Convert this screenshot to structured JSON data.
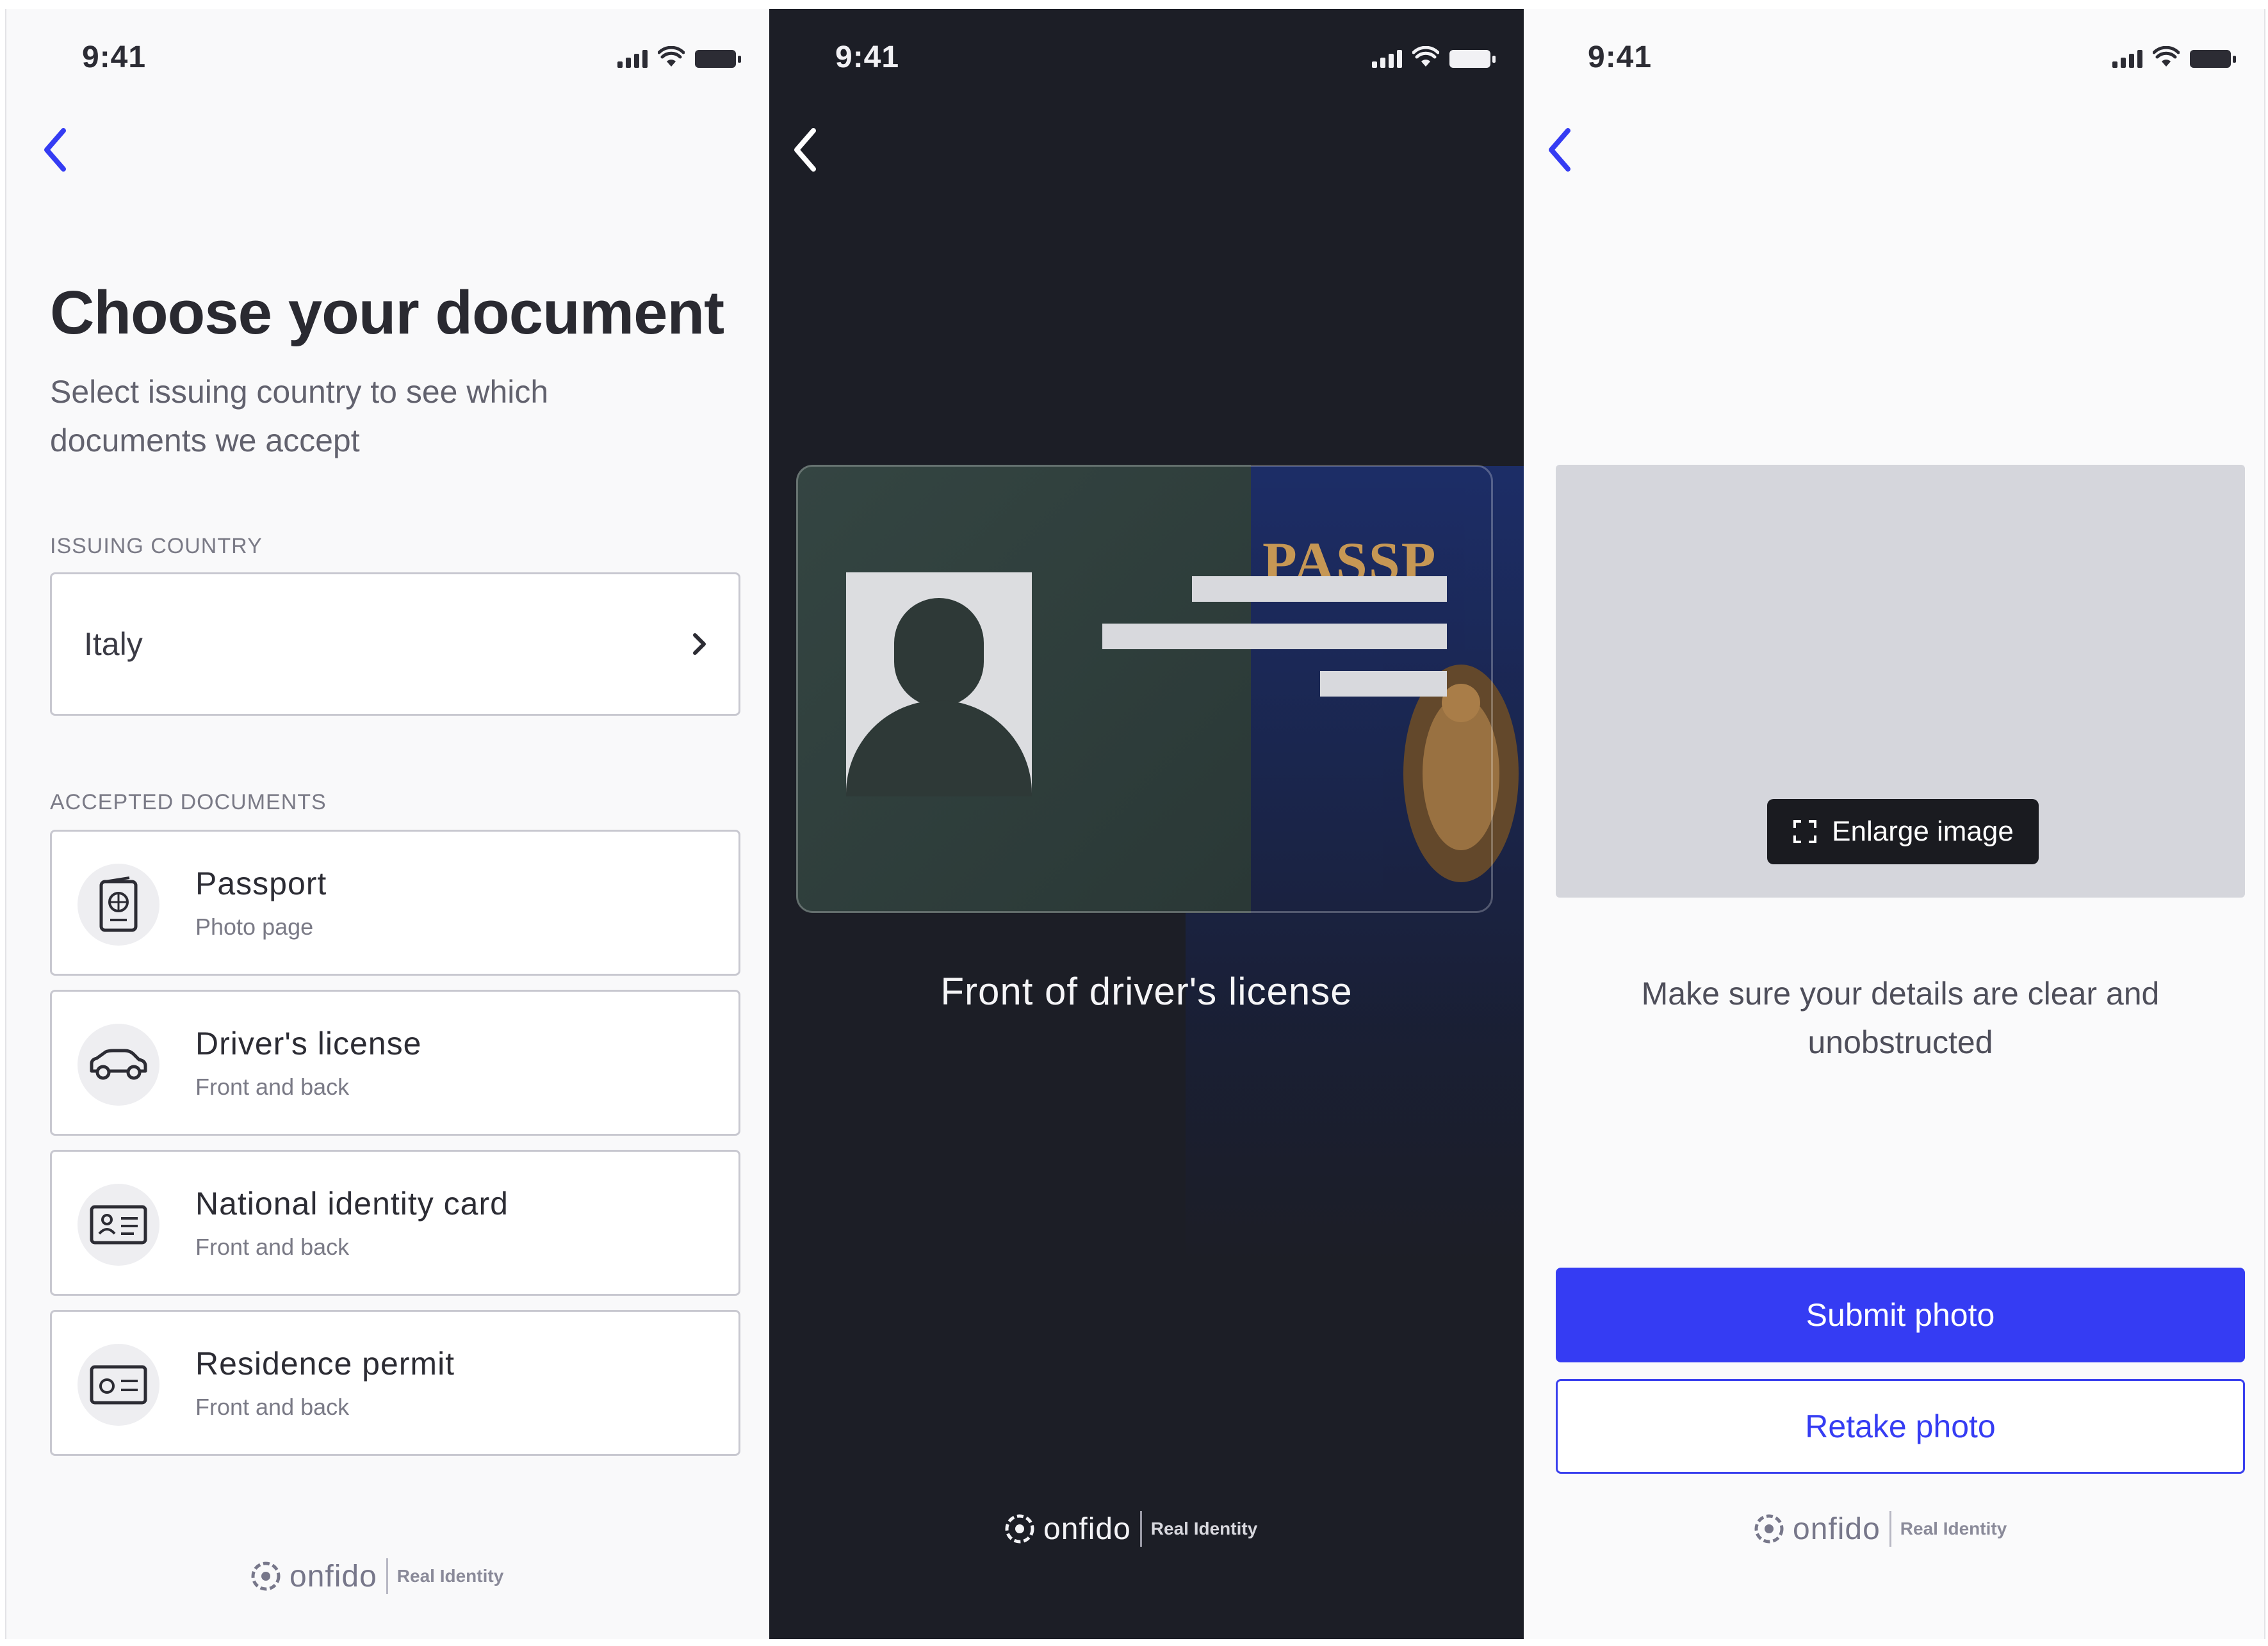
{
  "colors": {
    "accent": "#353cf3",
    "dark_background": "#1c1e26",
    "light_background": "#f9f9fa",
    "preview_grey": "#d5d6dc"
  },
  "brand": {
    "name": "onfido",
    "tagline": "Real Identity"
  },
  "screen1": {
    "time": "9:41",
    "title": "Choose your document",
    "subtitle": "Select issuing country to see which documents we accept",
    "country_label": "ISSUING COUNTRY",
    "country_value": "Italy",
    "documents_label": "ACCEPTED DOCUMENTS",
    "documents": [
      {
        "title": "Passport",
        "subtitle": "Photo page",
        "icon": "passport-icon"
      },
      {
        "title": "Driver's license",
        "subtitle": "Front and back",
        "icon": "car-icon"
      },
      {
        "title": "National identity card",
        "subtitle": "Front and back",
        "icon": "id-card-icon"
      },
      {
        "title": "Residence permit",
        "subtitle": "Front and back",
        "icon": "permit-card-icon"
      }
    ]
  },
  "screen2": {
    "time": "9:41",
    "passport_cover_text": "PASSP",
    "caption": "Front of driver's license"
  },
  "screen3": {
    "time": "9:41",
    "enlarge_label": "Enlarge image",
    "instruction": "Make sure your details are clear and unobstructed",
    "submit_label": "Submit photo",
    "retake_label": "Retake photo"
  }
}
